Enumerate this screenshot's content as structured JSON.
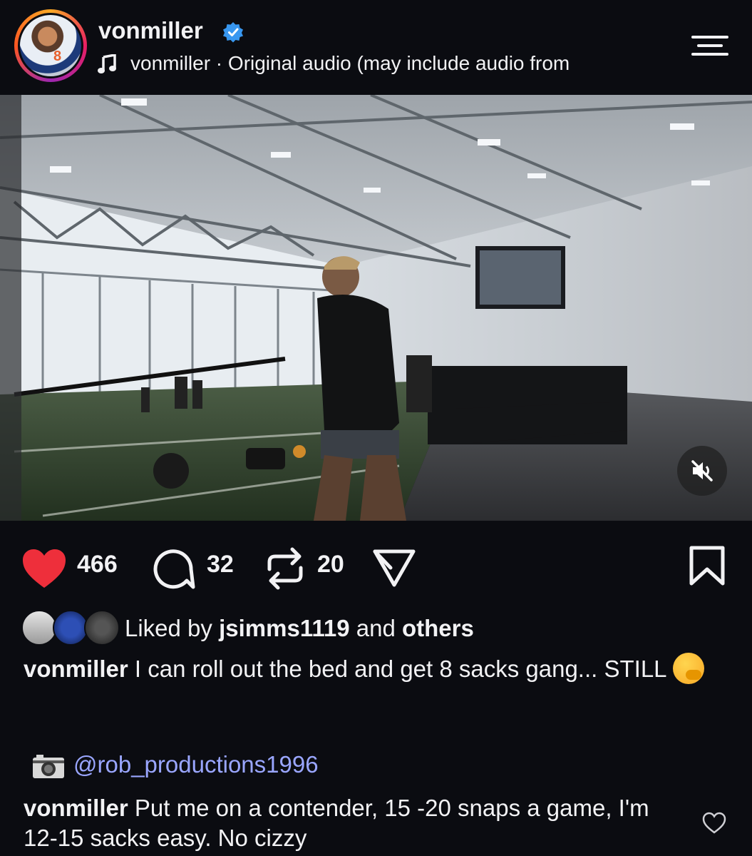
{
  "header": {
    "username": "vonmiller",
    "audio_text": "vonmiller · Original audio  (may include audio from",
    "avatar_jersey_number": "8"
  },
  "actions": {
    "likes": "466",
    "comments": "32",
    "reposts": "20"
  },
  "liked_by": {
    "prefix": "Liked by ",
    "user": "jsimms1119",
    "middle": " and ",
    "others": "others"
  },
  "caption": {
    "username": "vonmiller",
    "text": " I can roll out the bed and get 8 sacks gang... STILL"
  },
  "photo_credit": {
    "handle": "@rob_productions1996"
  },
  "comment": {
    "username": "vonmiller",
    "text": " Put me on a contender, 15 -20 snaps a game, I'm 12-15 sacks easy. No cizzy"
  },
  "colors": {
    "background": "#0b0c11",
    "like_red": "#ee2f3b",
    "verified_blue": "#3897f0",
    "link_blue": "#9aa6ff"
  },
  "icons": [
    "verified-icon",
    "music-note-icon",
    "menu-icon",
    "mute-icon",
    "heart-icon",
    "comment-icon",
    "repost-icon",
    "share-icon",
    "bookmark-icon",
    "camera-icon",
    "heart-outline-icon"
  ]
}
